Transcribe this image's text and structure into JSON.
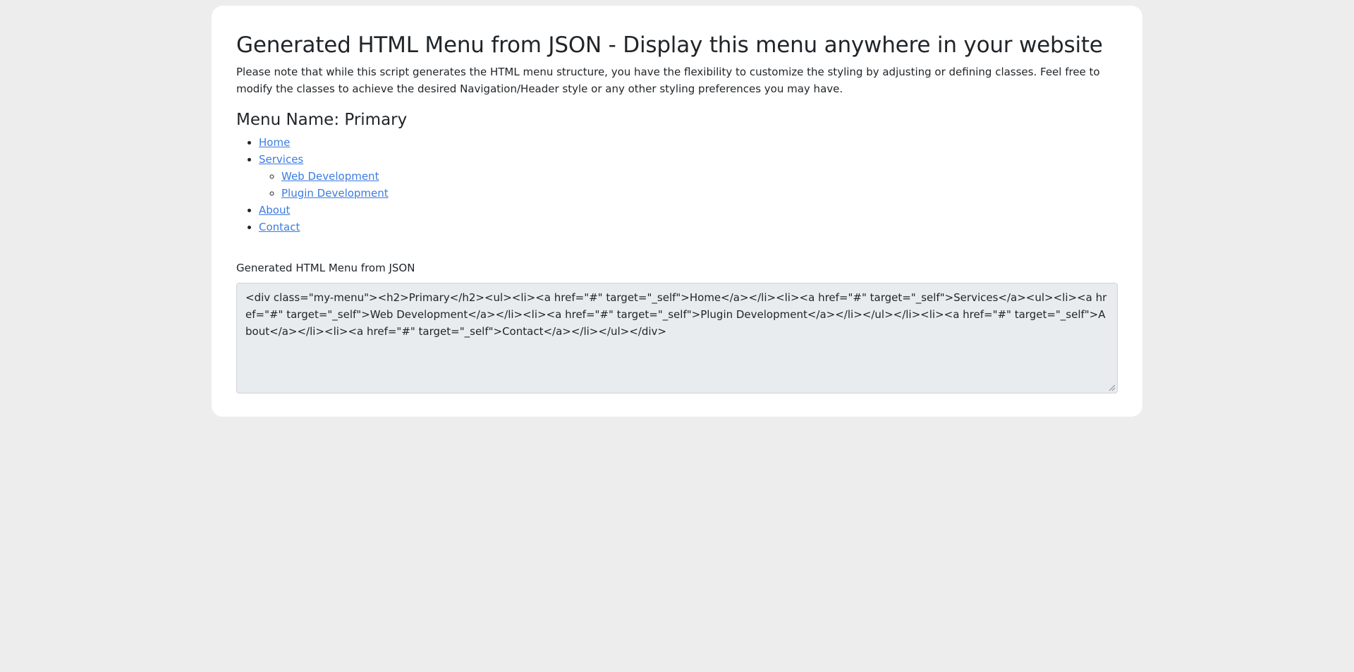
{
  "page": {
    "title": "Generated HTML Menu from JSON - Display this menu anywhere in your website",
    "intro": "Please note that while this script generates the HTML menu structure, you have the flexibility to customize the styling by adjusting or defining classes. Feel free to modify the classes to achieve the desired Navigation/Header style or any other styling preferences you may have."
  },
  "menu": {
    "heading": "Menu Name: Primary",
    "items": [
      {
        "label": "Home"
      },
      {
        "label": "Services",
        "children": [
          {
            "label": "Web Development"
          },
          {
            "label": "Plugin Development"
          }
        ]
      },
      {
        "label": "About"
      },
      {
        "label": "Contact"
      }
    ]
  },
  "output": {
    "label": "Generated HTML Menu from JSON",
    "code": "<div class=\"my-menu\"><h2>Primary</h2><ul><li><a href=\"#\" target=\"_self\">Home</a></li><li><a href=\"#\" target=\"_self\">Services</a><ul><li><a href=\"#\" target=\"_self\">Web Development</a></li><li><a href=\"#\" target=\"_self\">Plugin Development</a></li></ul></li><li><a href=\"#\" target=\"_self\">About</a></li><li><a href=\"#\" target=\"_self\">Contact</a></li></ul></div>"
  },
  "colors": {
    "background": "#ededed",
    "card": "#ffffff",
    "link": "#3c7be0",
    "textarea_bg": "#e9ecef"
  }
}
